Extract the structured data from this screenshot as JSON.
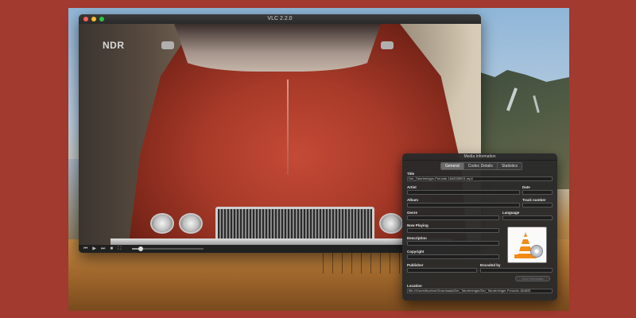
{
  "player": {
    "title": "VLC 2.2.0",
    "channel_logo": "NDR",
    "controls": {
      "rewind_icon": "⏮",
      "play_icon": "▶",
      "forward_icon": "⏭",
      "stop_icon": "■",
      "fullscreen_icon": "⛶"
    },
    "progress": 0.12
  },
  "media_info": {
    "window_title": "Media Information",
    "tabs": [
      {
        "label": "General",
        "active": true
      },
      {
        "label": "Codec Details",
        "active": false
      },
      {
        "label": "Statistics",
        "active": false
      }
    ],
    "fields": {
      "title_label": "Title",
      "title_value": "Der_Tatortreiniger-Freunde-1848335001.mp4",
      "artist_label": "Artist",
      "artist_value": "",
      "date_label": "Date",
      "date_value": "",
      "album_label": "Album",
      "album_value": "",
      "track_label": "Track number",
      "track_value": "",
      "genre_label": "Genre",
      "genre_value": "",
      "language_label": "Language",
      "language_value": "",
      "now_playing_label": "Now Playing",
      "now_playing_value": "",
      "description_label": "Description",
      "description_value": "",
      "copyright_label": "Copyright",
      "copyright_value": "",
      "publisher_label": "Publisher",
      "publisher_value": "",
      "encoded_by_label": "Encoded by",
      "encoded_by_value": "",
      "location_label": "Location",
      "location_value": "file:///Users/fkuehne/Downloads/Der_Tatortreiniger/Der_Tatortreiniger-Freunde-184833"
    },
    "save_button": "Save Metadata"
  },
  "colors": {
    "background": "#a33a2f",
    "traffic_red": "#fc5f57",
    "traffic_yellow": "#fdbc2e",
    "traffic_green": "#28c840"
  }
}
